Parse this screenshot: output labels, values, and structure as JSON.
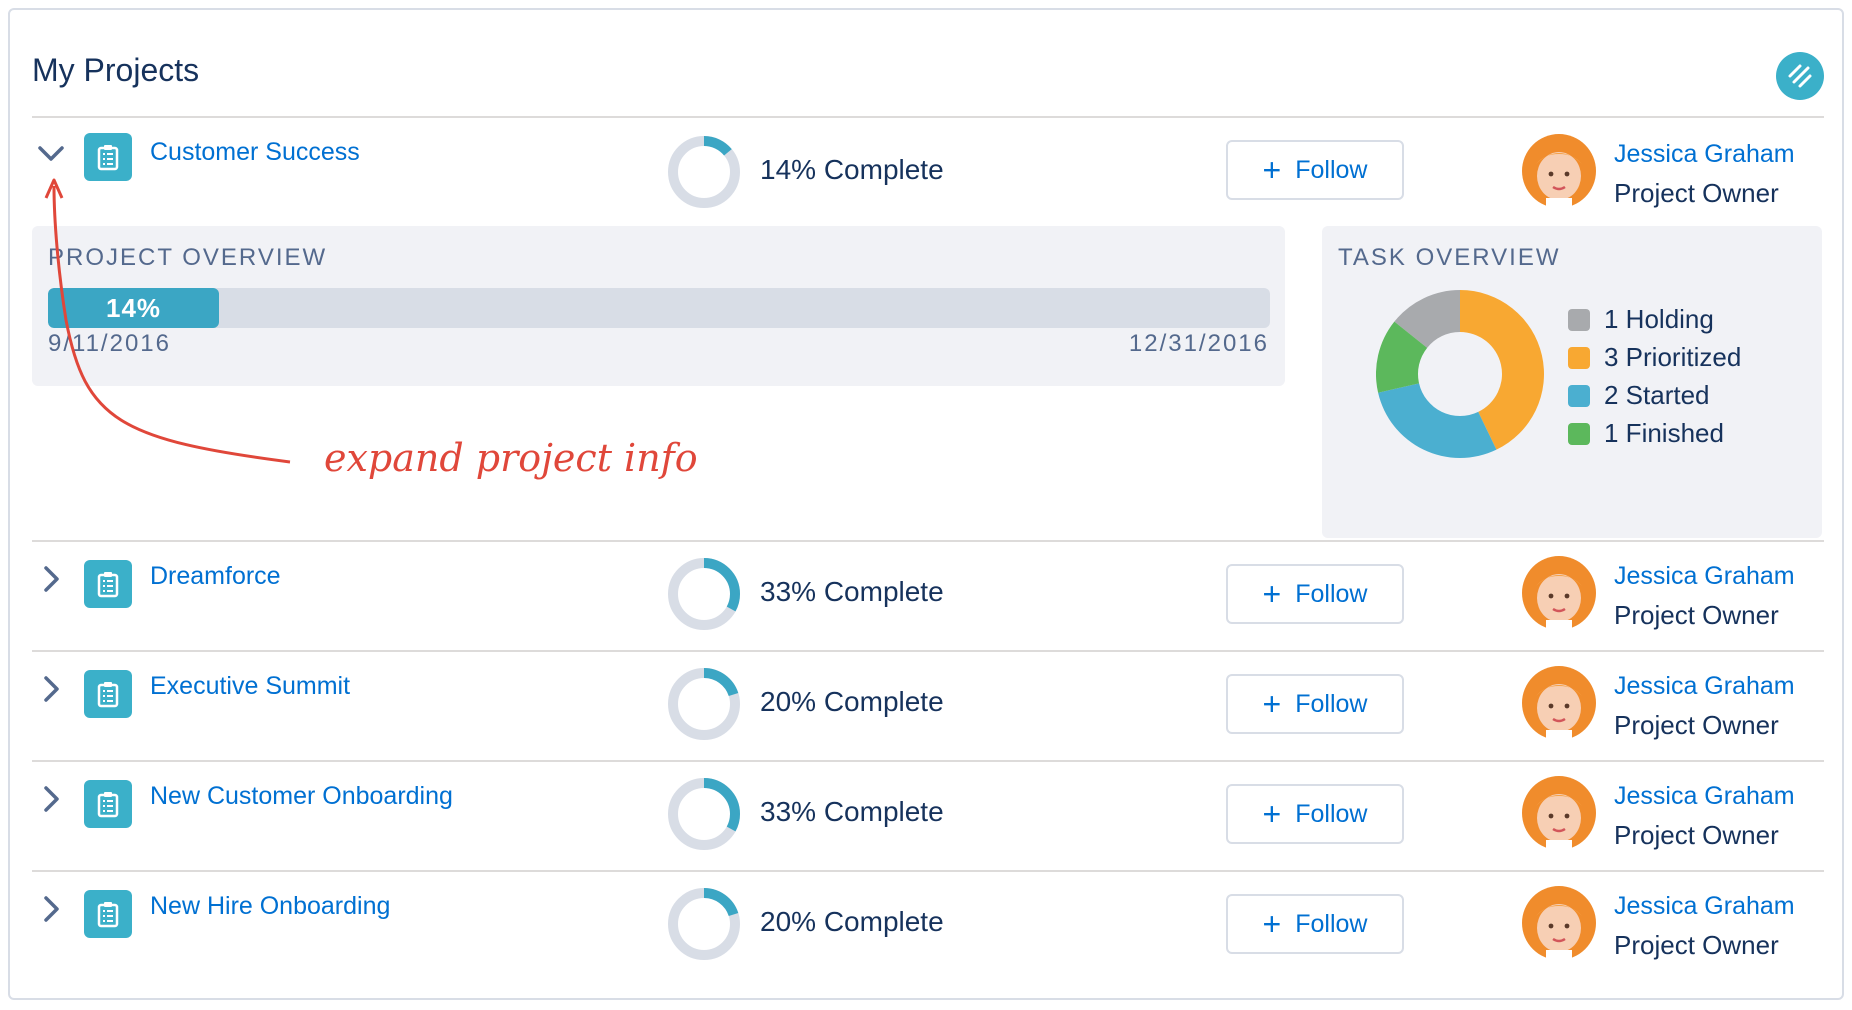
{
  "header": {
    "title": "My Projects",
    "action_icon": "edit-list-icon"
  },
  "colors": {
    "accent": "#3bb0c9",
    "link": "#0070d2",
    "text": "#16325c",
    "progress": "#3ba6c4",
    "annotation": "#e0473a"
  },
  "projects": [
    {
      "name": "Customer Success",
      "percent": 14,
      "complete_label": "14% Complete",
      "expanded": true,
      "follow_label": "Follow",
      "owner_name": "Jessica Graham",
      "owner_role": "Project Owner"
    },
    {
      "name": "Dreamforce",
      "percent": 33,
      "complete_label": "33% Complete",
      "expanded": false,
      "follow_label": "Follow",
      "owner_name": "Jessica Graham",
      "owner_role": "Project Owner"
    },
    {
      "name": "Executive Summit",
      "percent": 20,
      "complete_label": "20% Complete",
      "expanded": false,
      "follow_label": "Follow",
      "owner_name": "Jessica Graham",
      "owner_role": "Project Owner"
    },
    {
      "name": "New Customer Onboarding",
      "percent": 33,
      "complete_label": "33% Complete",
      "expanded": false,
      "follow_label": "Follow",
      "owner_name": "Jessica Graham",
      "owner_role": "Project Owner"
    },
    {
      "name": "New Hire Onboarding",
      "percent": 20,
      "complete_label": "20% Complete",
      "expanded": false,
      "follow_label": "Follow",
      "owner_name": "Jessica Graham",
      "owner_role": "Project Owner"
    }
  ],
  "project_overview": {
    "title": "PROJECT OVERVIEW",
    "percent": 14,
    "percent_label": "14%",
    "start_date": "9/11/2016",
    "end_date": "12/31/2016"
  },
  "task_overview": {
    "title": "TASK OVERVIEW",
    "items": [
      {
        "label": "1 Holding",
        "count": 1,
        "color": "#a8aaad"
      },
      {
        "label": "3 Prioritized",
        "count": 3,
        "color": "#f8a832"
      },
      {
        "label": "2 Started",
        "count": 2,
        "color": "#4bafd0"
      },
      {
        "label": "1 Finished",
        "count": 1,
        "color": "#5cb85c"
      }
    ]
  },
  "annotation": {
    "text": "expand project info"
  }
}
